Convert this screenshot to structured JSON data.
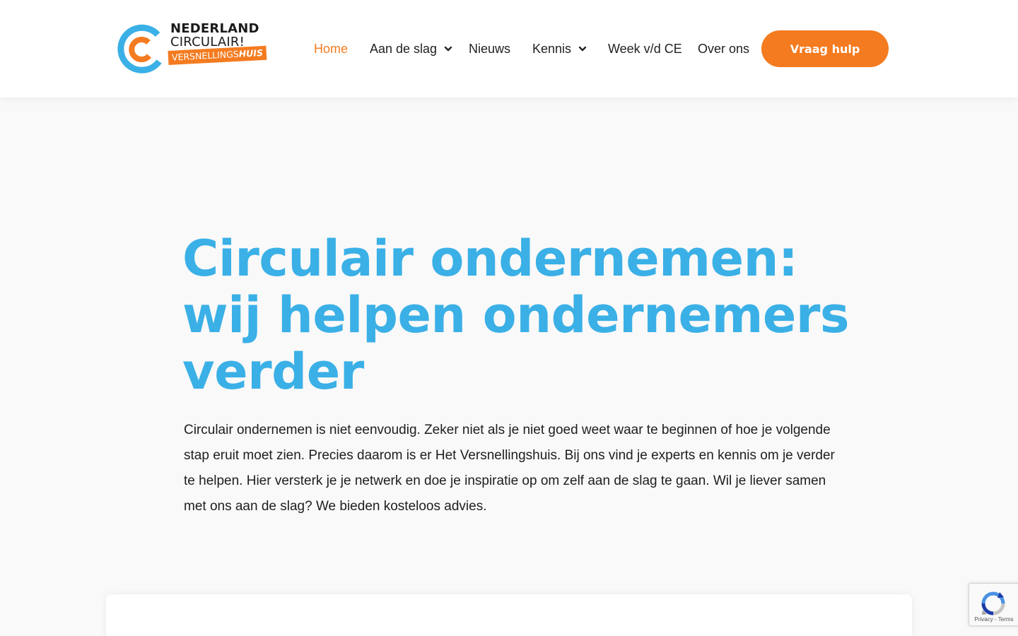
{
  "brand": {
    "line1": "NEDERLAND",
    "line2": "CIRCULAIR!",
    "tag_regular": "VERSNELLINGS",
    "tag_bold": "HUIS",
    "colors": {
      "orange": "#f47b20",
      "blue": "#3ab0e6"
    }
  },
  "nav": {
    "items": [
      {
        "label": "Home",
        "active": true,
        "dropdown": false
      },
      {
        "label": "Aan de slag",
        "active": false,
        "dropdown": true
      },
      {
        "label": "Nieuws",
        "active": false,
        "dropdown": false
      },
      {
        "label": "Kennis",
        "active": false,
        "dropdown": true
      },
      {
        "label": "Week v/d CE",
        "active": false,
        "dropdown": false
      },
      {
        "label": "Over ons",
        "active": false,
        "dropdown": false
      }
    ],
    "cta_label": "Vraag hulp",
    "dropdown_icon": "chevron-down-icon"
  },
  "hero": {
    "title_lines": [
      "Circulair ondernemen:",
      "wij helpen ondernemers",
      "verder"
    ],
    "body": "Circulair ondernemen is niet eenvoudig. Zeker niet als je niet goed weet waar te beginnen of hoe je volgende stap eruit moet zien. Precies daarom is er Het Versnellingshuis. Bij ons vind je experts en kennis om je verder te helpen. Hier versterk je je netwerk en doe je inspiratie op om zelf aan de slag te gaan. Wil je liever samen met ons aan de slag? We bieden kosteloos advies."
  },
  "recaptcha": {
    "privacy": "Privacy",
    "separator": " - ",
    "terms": "Terms"
  }
}
